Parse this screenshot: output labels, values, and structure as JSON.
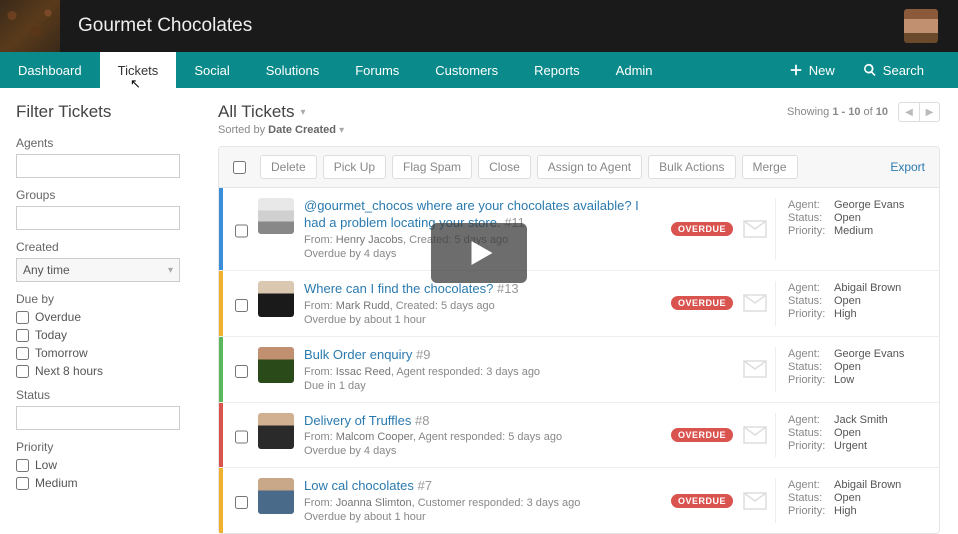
{
  "brand": {
    "title": "Gourmet Chocolates"
  },
  "nav": {
    "items": [
      {
        "label": "Dashboard"
      },
      {
        "label": "Tickets"
      },
      {
        "label": "Social"
      },
      {
        "label": "Solutions"
      },
      {
        "label": "Forums"
      },
      {
        "label": "Customers"
      },
      {
        "label": "Reports"
      },
      {
        "label": "Admin"
      }
    ],
    "new_label": "New",
    "search_label": "Search"
  },
  "sidebar": {
    "title": "Filter Tickets",
    "agents_label": "Agents",
    "groups_label": "Groups",
    "created_label": "Created",
    "created_value": "Any time",
    "dueby_label": "Due by",
    "dueby_options": [
      {
        "label": "Overdue"
      },
      {
        "label": "Today"
      },
      {
        "label": "Tomorrow"
      },
      {
        "label": "Next 8 hours"
      }
    ],
    "status_label": "Status",
    "priority_label": "Priority",
    "priority_options": [
      {
        "label": "Low"
      },
      {
        "label": "Medium"
      }
    ]
  },
  "main": {
    "title": "All Tickets",
    "sorted_prefix": "Sorted by ",
    "sorted_field": "Date Created",
    "showing_prefix": "Showing ",
    "showing_range": "1 - 10",
    "showing_of": " of ",
    "showing_total": "10"
  },
  "toolbar": {
    "delete": "Delete",
    "pickup": "Pick Up",
    "flagspam": "Flag Spam",
    "close": "Close",
    "assign": "Assign to Agent",
    "bulk": "Bulk Actions",
    "merge": "Merge",
    "export": "Export"
  },
  "meta_keys": {
    "agent": "Agent:",
    "status": "Status:",
    "priority": "Priority:"
  },
  "tickets": [
    {
      "stripe": "#3a8fd8",
      "title": "@gourmet_chocos where are your chocolates available? I had a problem locating your store.",
      "num": "#11",
      "from_label": "From: ",
      "from": "Henry Jacobs",
      "meta_sep": ", ",
      "meta2_label": "Created: ",
      "meta2_value": "5 days ago",
      "due": "Overdue by 4 days",
      "overdue": true,
      "badge": "OVERDUE",
      "agent": "George Evans",
      "status": "Open",
      "priority": "Medium",
      "avatar_class": "av1"
    },
    {
      "stripe": "#f0b030",
      "title": "Where can I find the chocolates?",
      "num": "#13",
      "from_label": "From: ",
      "from": "Mark Rudd",
      "meta_sep": ", ",
      "meta2_label": "Created: ",
      "meta2_value": "5 days ago",
      "due": "Overdue by about 1 hour",
      "overdue": true,
      "badge": "OVERDUE",
      "agent": "Abigail Brown",
      "status": "Open",
      "priority": "High",
      "avatar_class": "av2"
    },
    {
      "stripe": "#5cb85c",
      "title": "Bulk Order enquiry",
      "num": "#9",
      "from_label": "From: ",
      "from": "Issac Reed",
      "meta_sep": ", ",
      "meta2_label": "Agent responded: ",
      "meta2_value": "3 days ago",
      "due": "Due in 1 day",
      "overdue": false,
      "badge": "",
      "agent": "George Evans",
      "status": "Open",
      "priority": "Low",
      "avatar_class": "av3"
    },
    {
      "stripe": "#d9534f",
      "title": "Delivery of Truffles",
      "num": "#8",
      "from_label": "From: ",
      "from": "Malcom Cooper",
      "meta_sep": ", ",
      "meta2_label": "Agent responded: ",
      "meta2_value": "5 days ago",
      "due": "Overdue by 4 days",
      "overdue": true,
      "badge": "OVERDUE",
      "agent": "Jack Smith",
      "status": "Open",
      "priority": "Urgent",
      "avatar_class": "av4"
    },
    {
      "stripe": "#f0b030",
      "title": "Low cal chocolates",
      "num": "#7",
      "from_label": "From: ",
      "from": "Joanna Slimton",
      "meta_sep": ", ",
      "meta2_label": "Customer responded: ",
      "meta2_value": "3 days ago",
      "due": "Overdue by about 1 hour",
      "overdue": true,
      "badge": "OVERDUE",
      "agent": "Abigail Brown",
      "status": "Open",
      "priority": "High",
      "avatar_class": "av5"
    }
  ]
}
